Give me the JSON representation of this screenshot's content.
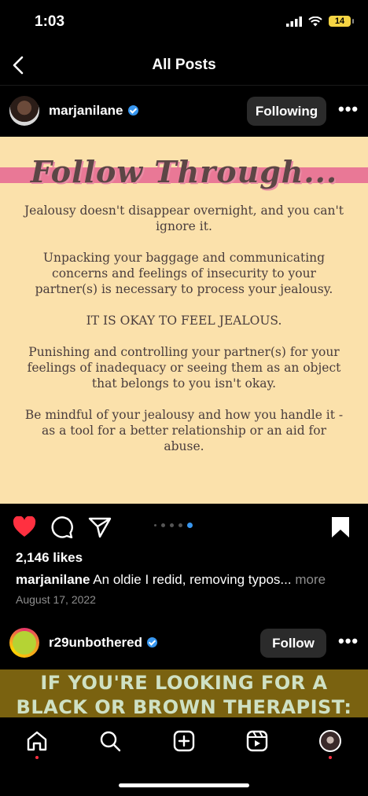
{
  "status": {
    "time": "1:03",
    "battery": "14"
  },
  "header": {
    "title": "All Posts"
  },
  "post1": {
    "username": "marjanilane",
    "following_label": "Following",
    "image": {
      "title": "Follow Through...",
      "paragraphs": [
        "Jealousy doesn't disappear overnight, and you can't ignore it.",
        "Unpacking your baggage and communicating concerns and feelings of insecurity to your partner(s) is necessary to process your jealousy.",
        "IT IS OKAY TO FEEL JEALOUS.",
        "Punishing and controlling your partner(s) for your feelings of inadequacy or seeing them as an object that belongs to you isn't okay.",
        "Be mindful of your jealousy and how you handle it - as a tool for a better relationship or an aid for abuse."
      ]
    },
    "likes": "2,146 likes",
    "caption_user": "marjanilane",
    "caption_text": "An oldie I redid, removing typos...",
    "caption_more": "more",
    "date": "August 17, 2022"
  },
  "post2": {
    "username": "r29unbothered",
    "follow_label": "Follow",
    "image_text_line1": "IF YOU'RE LOOKING FOR A",
    "image_text_line2": "BLACK OR BROWN THERAPIST:"
  },
  "icons": {
    "back": "chevron-left-icon",
    "verified": "verified-badge-icon",
    "like": "heart-filled-icon",
    "comment": "comment-icon",
    "share": "paper-plane-icon",
    "save": "bookmark-filled-icon",
    "nav": [
      "home-icon",
      "search-icon",
      "create-icon",
      "reels-icon",
      "profile-avatar"
    ]
  },
  "colors": {
    "like": "#ff3040",
    "verified": "#3897f0",
    "image_bg": "#fbe1ab",
    "band": "#e97896"
  }
}
